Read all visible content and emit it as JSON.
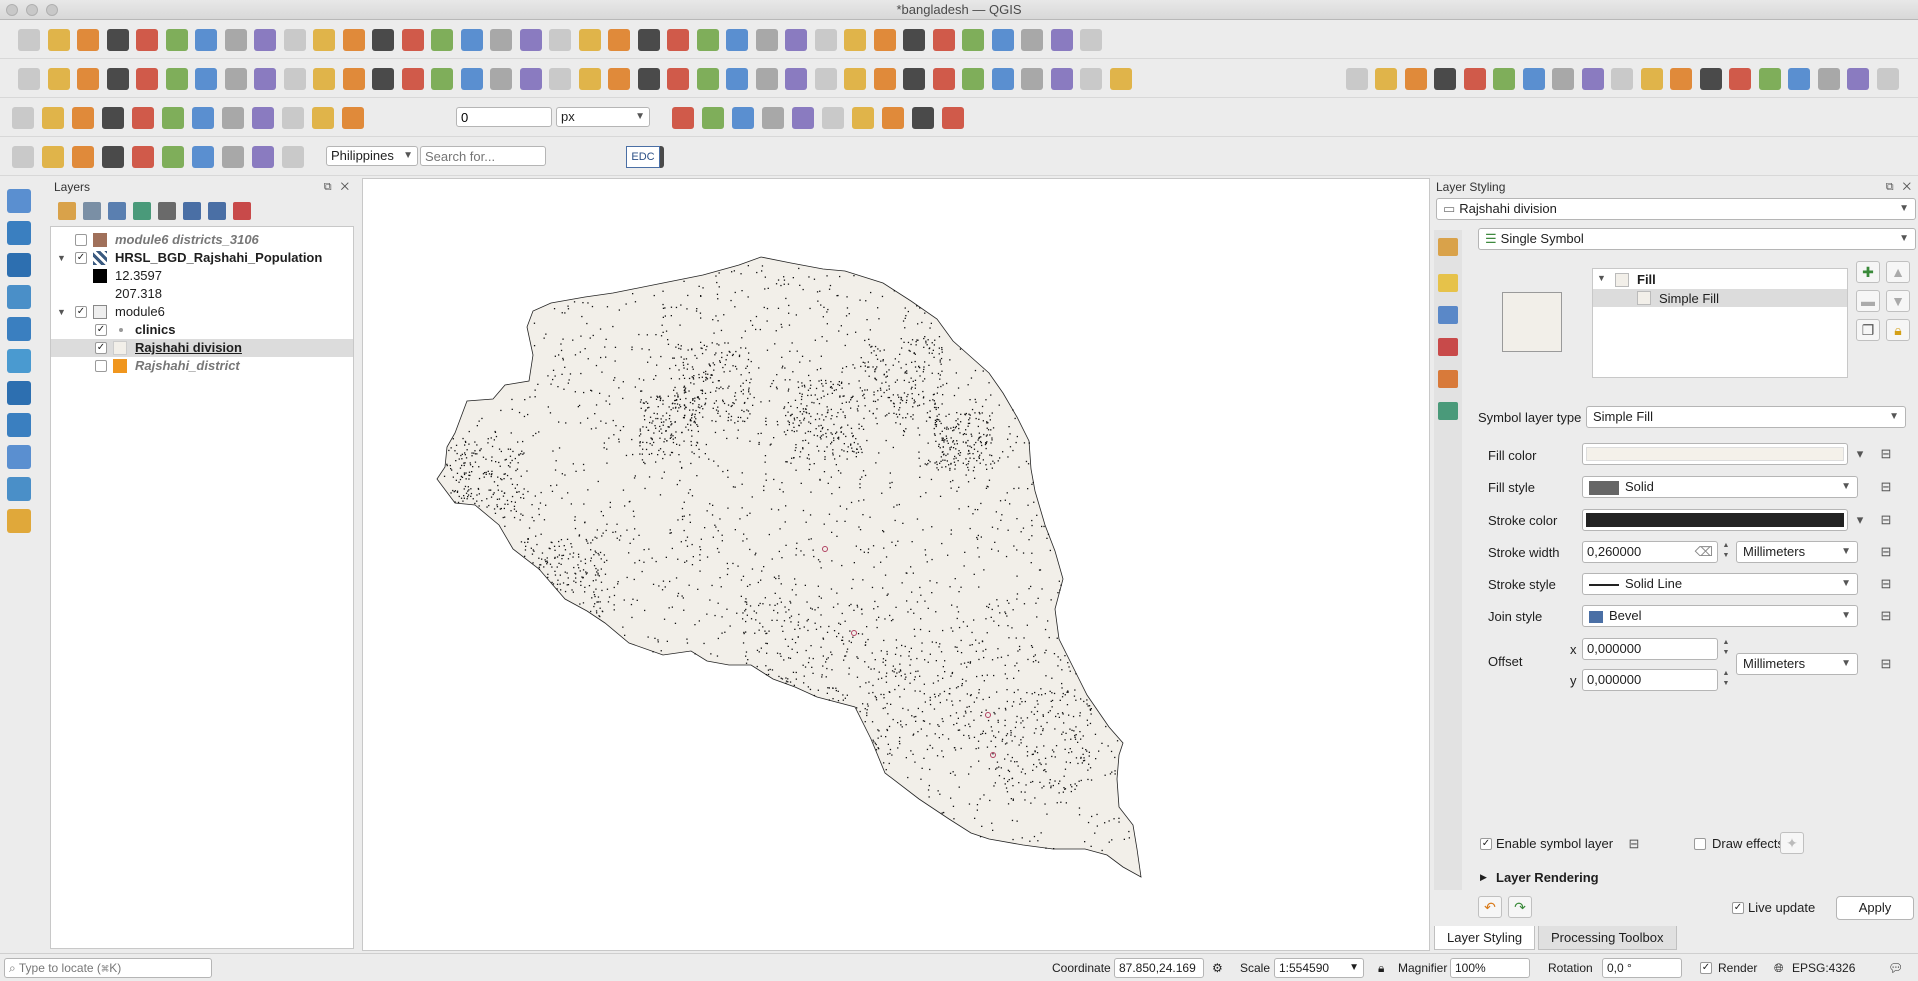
{
  "window": {
    "title": "*bangladesh — QGIS"
  },
  "toolbar": {
    "snap_tolerance": "0",
    "snap_unit": "px",
    "locator_region": "Philippines",
    "search_placeholder": "Search for...",
    "edc_label": "EDC"
  },
  "layers_panel": {
    "title": "Layers",
    "items": [
      {
        "label": "module6 districts_3106",
        "checked": false,
        "color": "#a0705a"
      },
      {
        "label": "HRSL_BGD_Rajshahi_Population",
        "checked": true
      },
      {
        "label": "12.3597",
        "color": "#000000"
      },
      {
        "label": "207.318",
        "color": "#ffffff"
      },
      {
        "label": "module6",
        "checked": true
      },
      {
        "label": "clinics",
        "checked": true
      },
      {
        "label": "Rajshahi division",
        "checked": true,
        "color": "#f2efe9"
      },
      {
        "label": "Rajshahi_district",
        "checked": false,
        "color": "#f0961e"
      }
    ]
  },
  "styling_panel": {
    "title": "Layer Styling",
    "layer": "Rajshahi division",
    "renderer": "Single Symbol",
    "tree": {
      "root": "Fill",
      "child": "Simple Fill"
    },
    "symbol_layer_type_label": "Symbol layer type",
    "symbol_layer_type": "Simple Fill",
    "fill_color_label": "Fill color",
    "fill_color": "#f4f1ea",
    "fill_style_label": "Fill style",
    "fill_style": "Solid",
    "stroke_color_label": "Stroke color",
    "stroke_color": "#232323",
    "stroke_width_label": "Stroke width",
    "stroke_width": "0,260000",
    "stroke_width_unit": "Millimeters",
    "stroke_style_label": "Stroke style",
    "stroke_style": "Solid Line",
    "join_style_label": "Join style",
    "join_style": "Bevel",
    "offset_label": "Offset",
    "offset_x_label": "x",
    "offset_y_label": "y",
    "offset_x": "0,000000",
    "offset_y": "0,000000",
    "offset_unit": "Millimeters",
    "enable_symbol_layer": "Enable symbol layer",
    "draw_effects": "Draw effects",
    "layer_rendering": "Layer Rendering",
    "live_update": "Live update",
    "apply": "Apply"
  },
  "bottom_tabs": [
    "Layer Styling",
    "Processing Toolbox"
  ],
  "status": {
    "locate_placeholder": "Type to locate (⌘K)",
    "coordinate_label": "Coordinate",
    "coordinate": "87.850,24.169",
    "scale_label": "Scale",
    "scale": "1:554590",
    "magnifier_label": "Magnifier",
    "magnifier": "100%",
    "rotation_label": "Rotation",
    "rotation": "0,0 °",
    "render_label": "Render",
    "crs": "EPSG:4326"
  }
}
